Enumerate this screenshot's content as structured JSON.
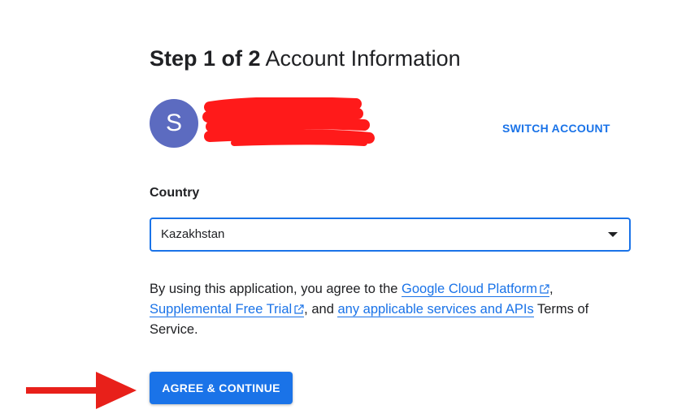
{
  "header": {
    "step": "Step 1 of 2",
    "title": "Account Information"
  },
  "account": {
    "avatar_letter": "S",
    "avatar_color": "#5c6bc0",
    "switch_label": "SWITCH ACCOUNT"
  },
  "country": {
    "label": "Country",
    "selected": "Kazakhstan"
  },
  "terms": {
    "prefix": "By using this application, you agree to the ",
    "link1": "Google Cloud Platform",
    "sep1": ",",
    "link2": "Supplemental Free Trial",
    "sep2": ", and ",
    "link3": "any applicable services and APIs",
    "suffix": " Terms of Service."
  },
  "actions": {
    "agree_label": "AGREE & CONTINUE"
  },
  "colors": {
    "accent": "#1a73e8",
    "annotation_arrow": "#e8201a",
    "redaction": "#ff1a1a"
  },
  "icons": {
    "external_link": "external-link-icon",
    "dropdown": "chevron-down-icon"
  }
}
